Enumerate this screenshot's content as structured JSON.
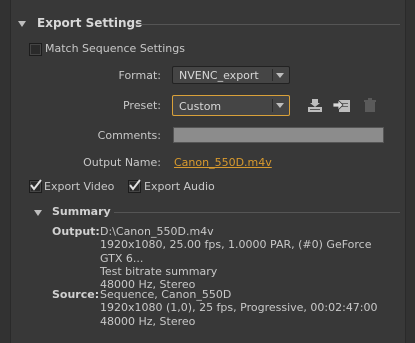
{
  "section": {
    "title": "Export Settings"
  },
  "match_sequence": {
    "label": "Match Sequence Settings",
    "checked": false
  },
  "format": {
    "label": "Format:",
    "value": "NVENC_export"
  },
  "preset": {
    "label": "Preset:",
    "value": "Custom"
  },
  "preset_actions": {
    "icons": [
      "save-preset-icon",
      "import-preset-icon",
      "delete-preset-icon"
    ]
  },
  "comments": {
    "label": "Comments:",
    "value": ""
  },
  "output_name": {
    "label": "Output Name:",
    "value": "Canon_550D.m4v"
  },
  "export_video": {
    "label": "Export Video",
    "checked": true
  },
  "export_audio": {
    "label": "Export Audio",
    "checked": true
  },
  "summary": {
    "title": "Summary",
    "output_label": "Output:",
    "output_lines": [
      "D:\\Canon_550D.m4v",
      "1920x1080, 25.00 fps, 1.0000 PAR, (#0) GeForce GTX 6...",
      "Test bitrate summary",
      "48000 Hz, Stereo"
    ],
    "source_label": "Source:",
    "source_lines": [
      "Sequence, Canon_550D",
      "1920x1080 (1,0), 25 fps, Progressive, 00:02:47:00",
      "48000 Hz, Stereo"
    ]
  },
  "colors": {
    "background": "#383838",
    "accent_link": "#d89a2e",
    "focus_border": "#d9a13a"
  }
}
